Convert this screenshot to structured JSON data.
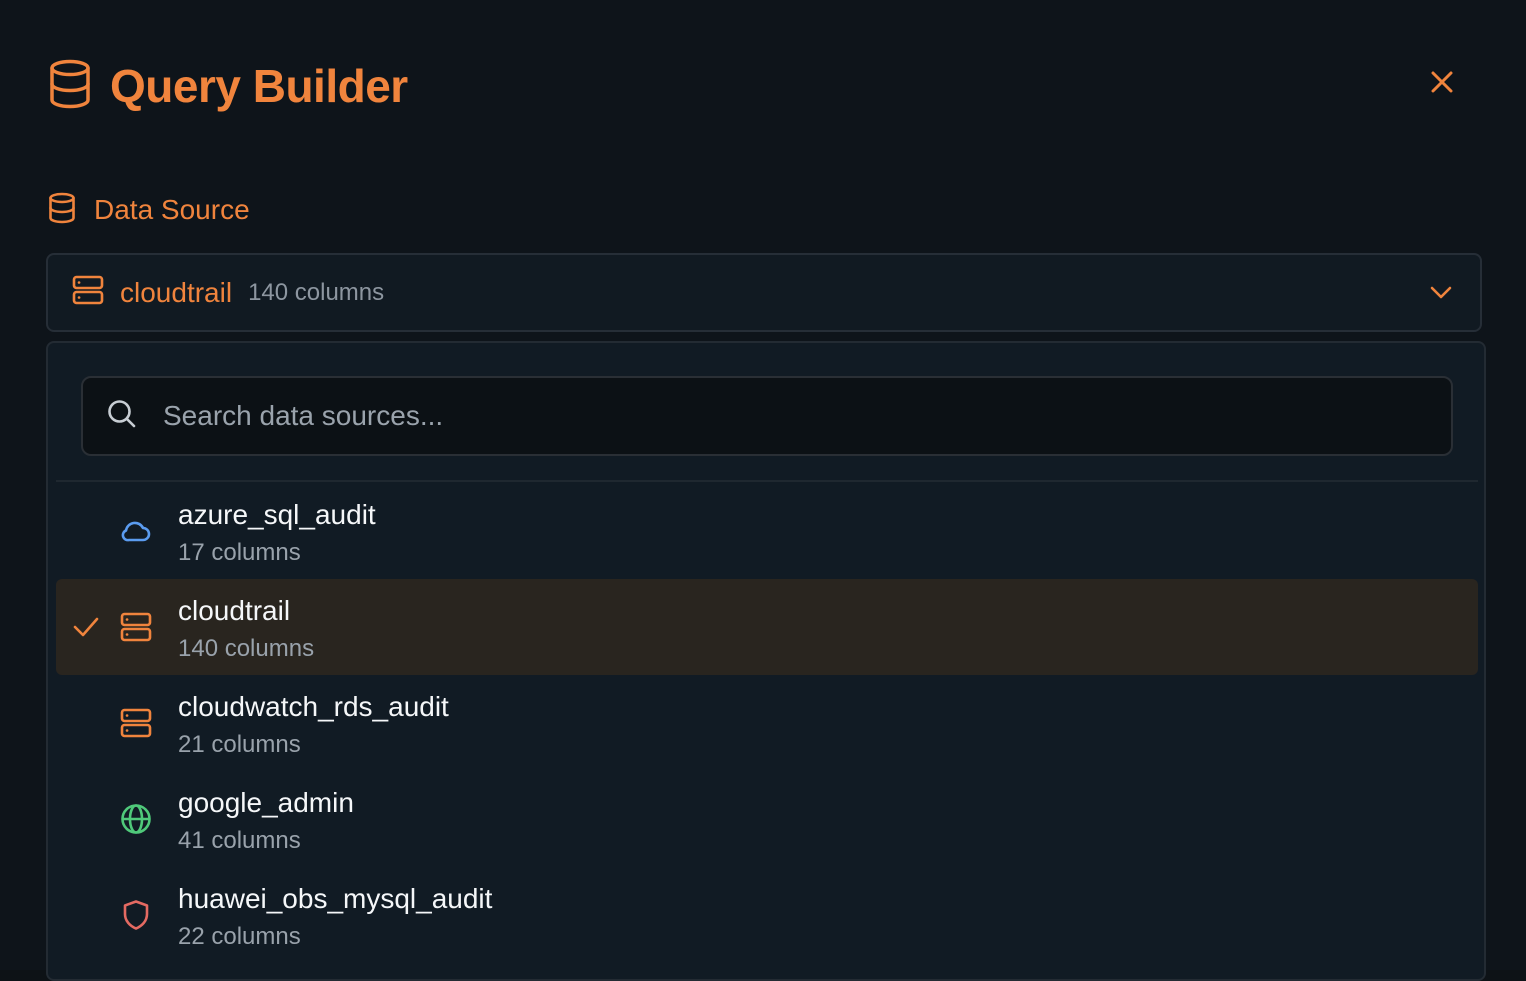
{
  "header": {
    "title": "Query Builder",
    "icon": "database-icon",
    "close_icon": "close-icon"
  },
  "data_source": {
    "label": "Data Source",
    "icon": "database-icon"
  },
  "select": {
    "icon": "server-icon",
    "name": "cloudtrail",
    "columns": "140 columns",
    "chevron": "chevron-down-icon"
  },
  "search": {
    "placeholder": "Search data sources..."
  },
  "sources": [
    {
      "name": "azure_sql_audit",
      "columns": "17 columns",
      "icon": "cloud-icon",
      "selected": false
    },
    {
      "name": "cloudtrail",
      "columns": "140 columns",
      "icon": "server-icon",
      "selected": true
    },
    {
      "name": "cloudwatch_rds_audit",
      "columns": "21 columns",
      "icon": "server-icon",
      "selected": false
    },
    {
      "name": "google_admin",
      "columns": "41 columns",
      "icon": "globe-icon",
      "selected": false
    },
    {
      "name": "huawei_obs_mysql_audit",
      "columns": "22 columns",
      "icon": "shield-icon",
      "selected": false
    }
  ],
  "colors": {
    "accent": "#f0843d",
    "cloud": "#5b9cf0",
    "globe": "#4fc97a",
    "shield": "#e46a62"
  }
}
